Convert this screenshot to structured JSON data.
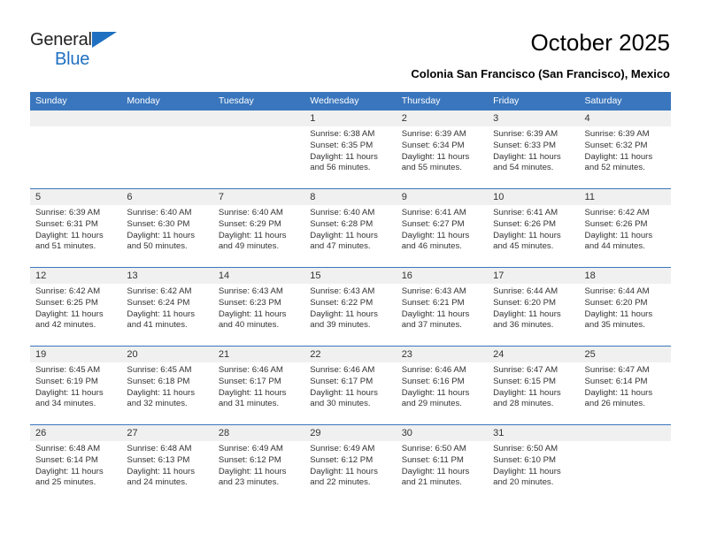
{
  "logo": {
    "word1": "General",
    "word2": "Blue",
    "triangle_color": "#1f70c1"
  },
  "header": {
    "title": "October 2025",
    "subtitle": "Colonia San Francisco (San Francisco), Mexico"
  },
  "theme": {
    "header_bg": "#3a76bd",
    "header_text": "#ffffff",
    "daynum_bg": "#f0f0f0",
    "cell_bg": "#ffffff",
    "body_text": "#333333"
  },
  "weekdays": [
    "Sunday",
    "Monday",
    "Tuesday",
    "Wednesday",
    "Thursday",
    "Friday",
    "Saturday"
  ],
  "weeks": [
    [
      {
        "day": "",
        "lines": []
      },
      {
        "day": "",
        "lines": []
      },
      {
        "day": "",
        "lines": []
      },
      {
        "day": "1",
        "lines": [
          "Sunrise: 6:38 AM",
          "Sunset: 6:35 PM",
          "Daylight: 11 hours",
          "and 56 minutes."
        ]
      },
      {
        "day": "2",
        "lines": [
          "Sunrise: 6:39 AM",
          "Sunset: 6:34 PM",
          "Daylight: 11 hours",
          "and 55 minutes."
        ]
      },
      {
        "day": "3",
        "lines": [
          "Sunrise: 6:39 AM",
          "Sunset: 6:33 PM",
          "Daylight: 11 hours",
          "and 54 minutes."
        ]
      },
      {
        "day": "4",
        "lines": [
          "Sunrise: 6:39 AM",
          "Sunset: 6:32 PM",
          "Daylight: 11 hours",
          "and 52 minutes."
        ]
      }
    ],
    [
      {
        "day": "5",
        "lines": [
          "Sunrise: 6:39 AM",
          "Sunset: 6:31 PM",
          "Daylight: 11 hours",
          "and 51 minutes."
        ]
      },
      {
        "day": "6",
        "lines": [
          "Sunrise: 6:40 AM",
          "Sunset: 6:30 PM",
          "Daylight: 11 hours",
          "and 50 minutes."
        ]
      },
      {
        "day": "7",
        "lines": [
          "Sunrise: 6:40 AM",
          "Sunset: 6:29 PM",
          "Daylight: 11 hours",
          "and 49 minutes."
        ]
      },
      {
        "day": "8",
        "lines": [
          "Sunrise: 6:40 AM",
          "Sunset: 6:28 PM",
          "Daylight: 11 hours",
          "and 47 minutes."
        ]
      },
      {
        "day": "9",
        "lines": [
          "Sunrise: 6:41 AM",
          "Sunset: 6:27 PM",
          "Daylight: 11 hours",
          "and 46 minutes."
        ]
      },
      {
        "day": "10",
        "lines": [
          "Sunrise: 6:41 AM",
          "Sunset: 6:26 PM",
          "Daylight: 11 hours",
          "and 45 minutes."
        ]
      },
      {
        "day": "11",
        "lines": [
          "Sunrise: 6:42 AM",
          "Sunset: 6:26 PM",
          "Daylight: 11 hours",
          "and 44 minutes."
        ]
      }
    ],
    [
      {
        "day": "12",
        "lines": [
          "Sunrise: 6:42 AM",
          "Sunset: 6:25 PM",
          "Daylight: 11 hours",
          "and 42 minutes."
        ]
      },
      {
        "day": "13",
        "lines": [
          "Sunrise: 6:42 AM",
          "Sunset: 6:24 PM",
          "Daylight: 11 hours",
          "and 41 minutes."
        ]
      },
      {
        "day": "14",
        "lines": [
          "Sunrise: 6:43 AM",
          "Sunset: 6:23 PM",
          "Daylight: 11 hours",
          "and 40 minutes."
        ]
      },
      {
        "day": "15",
        "lines": [
          "Sunrise: 6:43 AM",
          "Sunset: 6:22 PM",
          "Daylight: 11 hours",
          "and 39 minutes."
        ]
      },
      {
        "day": "16",
        "lines": [
          "Sunrise: 6:43 AM",
          "Sunset: 6:21 PM",
          "Daylight: 11 hours",
          "and 37 minutes."
        ]
      },
      {
        "day": "17",
        "lines": [
          "Sunrise: 6:44 AM",
          "Sunset: 6:20 PM",
          "Daylight: 11 hours",
          "and 36 minutes."
        ]
      },
      {
        "day": "18",
        "lines": [
          "Sunrise: 6:44 AM",
          "Sunset: 6:20 PM",
          "Daylight: 11 hours",
          "and 35 minutes."
        ]
      }
    ],
    [
      {
        "day": "19",
        "lines": [
          "Sunrise: 6:45 AM",
          "Sunset: 6:19 PM",
          "Daylight: 11 hours",
          "and 34 minutes."
        ]
      },
      {
        "day": "20",
        "lines": [
          "Sunrise: 6:45 AM",
          "Sunset: 6:18 PM",
          "Daylight: 11 hours",
          "and 32 minutes."
        ]
      },
      {
        "day": "21",
        "lines": [
          "Sunrise: 6:46 AM",
          "Sunset: 6:17 PM",
          "Daylight: 11 hours",
          "and 31 minutes."
        ]
      },
      {
        "day": "22",
        "lines": [
          "Sunrise: 6:46 AM",
          "Sunset: 6:17 PM",
          "Daylight: 11 hours",
          "and 30 minutes."
        ]
      },
      {
        "day": "23",
        "lines": [
          "Sunrise: 6:46 AM",
          "Sunset: 6:16 PM",
          "Daylight: 11 hours",
          "and 29 minutes."
        ]
      },
      {
        "day": "24",
        "lines": [
          "Sunrise: 6:47 AM",
          "Sunset: 6:15 PM",
          "Daylight: 11 hours",
          "and 28 minutes."
        ]
      },
      {
        "day": "25",
        "lines": [
          "Sunrise: 6:47 AM",
          "Sunset: 6:14 PM",
          "Daylight: 11 hours",
          "and 26 minutes."
        ]
      }
    ],
    [
      {
        "day": "26",
        "lines": [
          "Sunrise: 6:48 AM",
          "Sunset: 6:14 PM",
          "Daylight: 11 hours",
          "and 25 minutes."
        ]
      },
      {
        "day": "27",
        "lines": [
          "Sunrise: 6:48 AM",
          "Sunset: 6:13 PM",
          "Daylight: 11 hours",
          "and 24 minutes."
        ]
      },
      {
        "day": "28",
        "lines": [
          "Sunrise: 6:49 AM",
          "Sunset: 6:12 PM",
          "Daylight: 11 hours",
          "and 23 minutes."
        ]
      },
      {
        "day": "29",
        "lines": [
          "Sunrise: 6:49 AM",
          "Sunset: 6:12 PM",
          "Daylight: 11 hours",
          "and 22 minutes."
        ]
      },
      {
        "day": "30",
        "lines": [
          "Sunrise: 6:50 AM",
          "Sunset: 6:11 PM",
          "Daylight: 11 hours",
          "and 21 minutes."
        ]
      },
      {
        "day": "31",
        "lines": [
          "Sunrise: 6:50 AM",
          "Sunset: 6:10 PM",
          "Daylight: 11 hours",
          "and 20 minutes."
        ]
      },
      {
        "day": "",
        "lines": []
      }
    ]
  ]
}
